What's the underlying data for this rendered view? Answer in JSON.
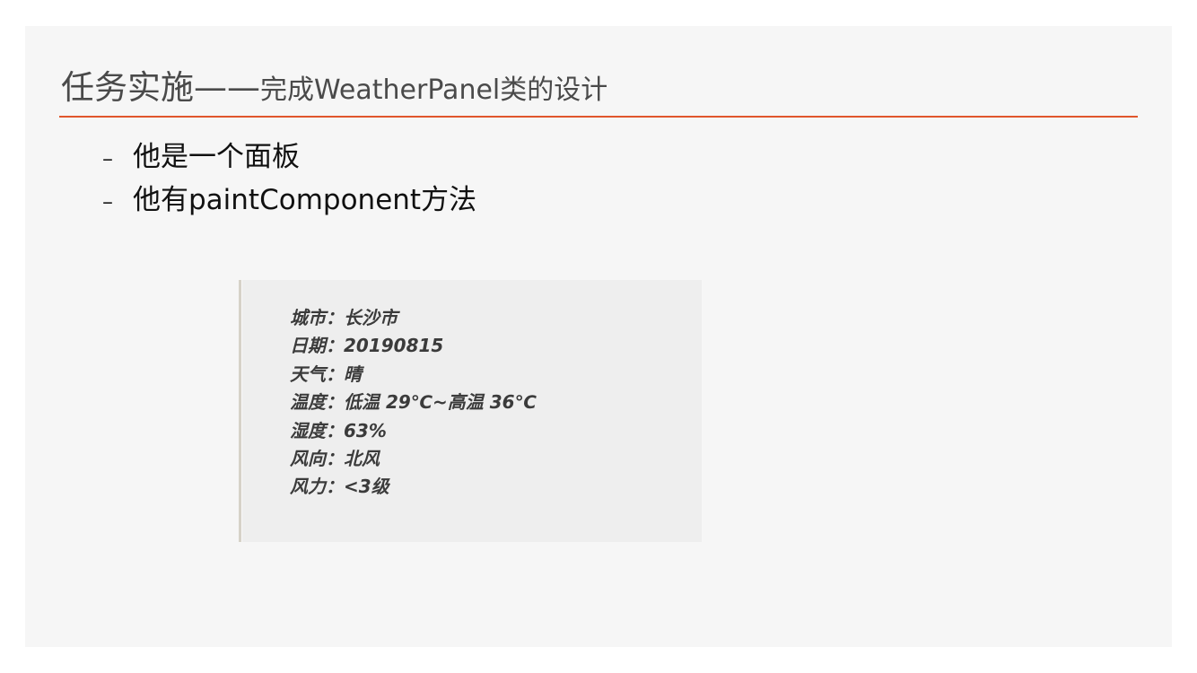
{
  "slide": {
    "title_main": "任务实施——",
    "title_sub": "完成WeatherPanel类的设计",
    "accent_color": "#e0562c",
    "bullets": [
      {
        "marker": "–",
        "text": "他是一个面板"
      },
      {
        "marker": "–",
        "text": "他有paintComponent方法"
      }
    ]
  },
  "weather_panel": {
    "lines": [
      "城市：长沙市",
      "日期：20190815",
      "天气：晴",
      "温度：低温 29℃~高温 36℃",
      "湿度：63%",
      "风向：北风",
      "风力：<3级"
    ]
  }
}
